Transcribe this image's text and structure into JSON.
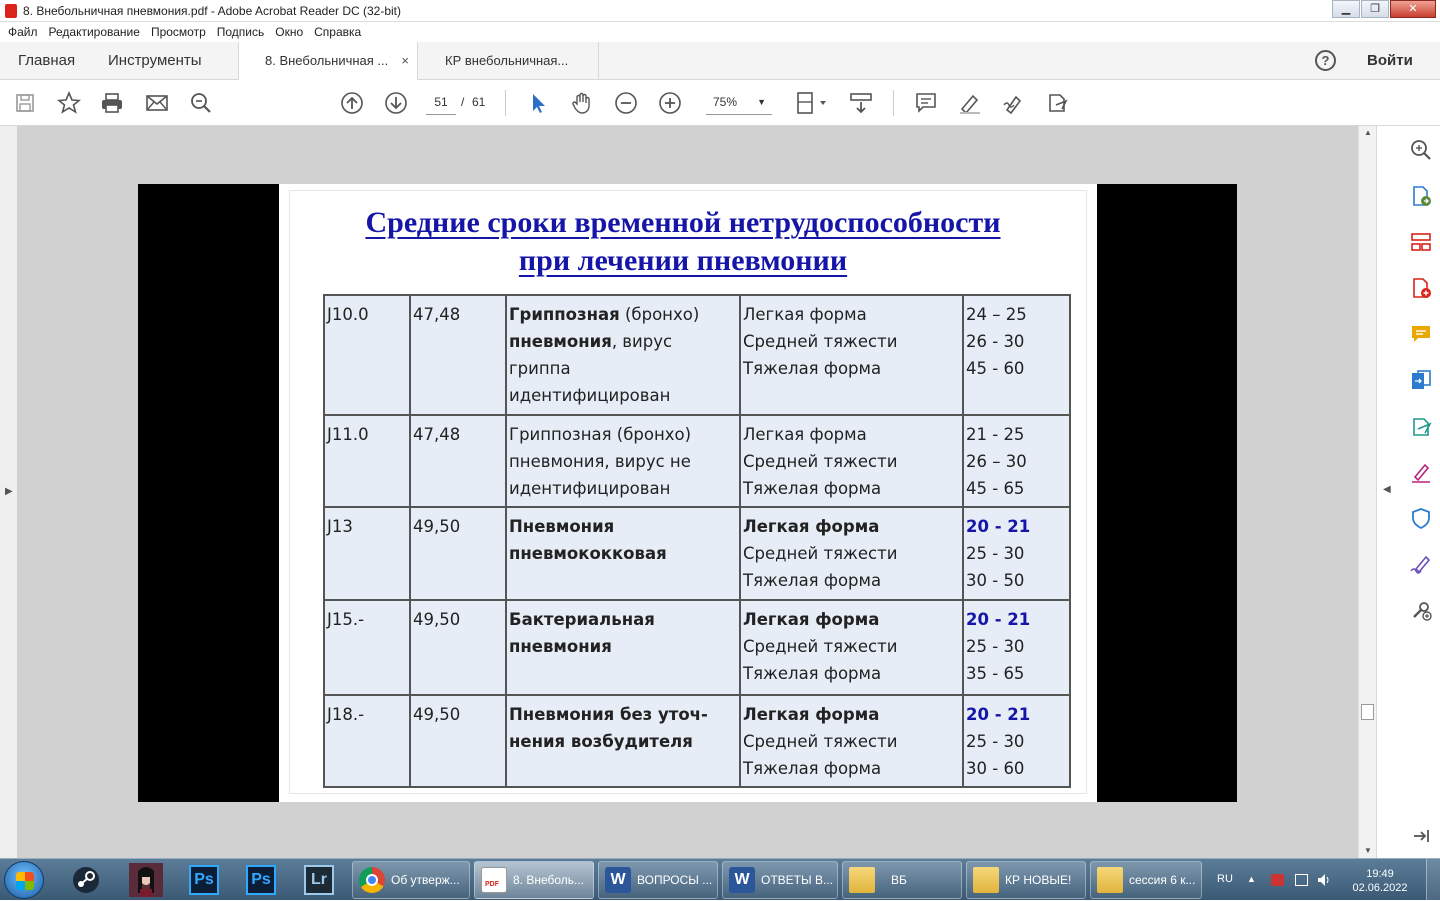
{
  "window": {
    "title": "8. Внебольничная пневмония.pdf - Adobe Acrobat Reader DC (32-bit)",
    "controls": {
      "minimize": "▁",
      "maximize": "❐",
      "close": "✕"
    }
  },
  "menu": [
    "Файл",
    "Редактирование",
    "Просмотр",
    "Подпись",
    "Окно",
    "Справка"
  ],
  "tabs": {
    "home": "Главная",
    "tools": "Инструменты",
    "doc1": "8. Внебольничная ...",
    "doc1_close": "×",
    "doc2": "КР внебольничная...",
    "help": "?",
    "signin": "Войти"
  },
  "toolbar": {
    "icons": [
      "save-icon",
      "bookmark-star-icon",
      "print-icon",
      "email-icon",
      "search-zoom-icon",
      "prev-page-icon",
      "next-page-icon",
      "select-cursor-icon",
      "hand-icon",
      "zoom-out-icon",
      "zoom-in-icon",
      "page-fit-icon",
      "scroll-mode-icon",
      "comment-icon",
      "highlight-icon",
      "sign-icon",
      "share-icon"
    ],
    "page_current": "51",
    "page_sep": "/",
    "page_total": "61",
    "zoom": "75%"
  },
  "right_panel": {
    "icons": [
      "zoom-search-icon",
      "export-pdf-icon",
      "organize-pages-icon",
      "create-pdf-icon",
      "comment-icon",
      "combine-files-icon",
      "send-review-icon",
      "fill-sign-icon",
      "protect-icon",
      "sign-pen-icon",
      "more-tools-icon",
      "collapse-panel-icon"
    ]
  },
  "slide": {
    "title_line1": "Средние сроки временной нетрудоспособности",
    "title_line2": "при лечении пневмонии",
    "rows": [
      {
        "code": "J10.0",
        "price": "47,48",
        "diag_bold1": "Гриппозная",
        "diag_reg1": " (бронхо)",
        "diag_bold2": "пневмония",
        "diag_reg2": ", вирус",
        "diag_reg3": "гриппа идентифицирован",
        "forms": [
          "Легкая форма",
          "Средней тяжести",
          "Тяжелая форма"
        ],
        "terms": [
          "24 – 25",
          "26 - 30",
          "45 - 60"
        ]
      },
      {
        "code": "J11.0",
        "price": "47,48",
        "diag_lines": [
          "Гриппозная (бронхо)",
          "пневмония, вирус не",
          "идентифицирован"
        ],
        "forms": [
          "Легкая форма",
          "Средней тяжести",
          "Тяжелая форма"
        ],
        "terms": [
          "21 - 25",
          "26 – 30",
          "45 - 65"
        ]
      },
      {
        "code": "J13",
        "price": "49,50",
        "diag_lines": [
          "Пневмония",
          "пневмококковая"
        ],
        "forms": [
          "Легкая форма",
          "Средней тяжести",
          "Тяжелая форма"
        ],
        "terms": [
          "20 - 21",
          "25 - 30",
          "30 - 50"
        ]
      },
      {
        "code": "J15.-",
        "price": "49,50",
        "diag_lines": [
          "Бактериальная",
          "пневмония"
        ],
        "forms": [
          "Легкая форма",
          "Средней тяжести",
          "Тяжелая форма"
        ],
        "terms": [
          "20 - 21",
          "25 - 30",
          "35 - 65"
        ]
      },
      {
        "code": "J18.-",
        "price": "49,50",
        "diag_lines": [
          "Пневмония без уточ-",
          "нения возбудителя"
        ],
        "forms": [
          "Легкая форма",
          "Средней тяжести",
          "Тяжелая форма"
        ],
        "terms": [
          "20 - 21",
          "25 - 30",
          "30 - 60"
        ]
      }
    ]
  },
  "taskbar": {
    "pinned": [
      "steam-icon",
      "game-avatar-icon",
      "photoshop-icon",
      "photoshop-icon",
      "lightroom-icon"
    ],
    "pinned_labels": [
      "Ps",
      "Ps",
      "Lr"
    ],
    "tasks": [
      {
        "label": "Об утверж...",
        "icon": "chrome-icon"
      },
      {
        "label": "8. Внеболь...",
        "icon": "pdf-icon",
        "icon_text": "PDF"
      },
      {
        "label": "ВОПРОСЫ ...",
        "icon": "word-icon",
        "icon_text": "W"
      },
      {
        "label": "ОТВЕТЫ В...",
        "icon": "word-icon",
        "icon_text": "W"
      },
      {
        "label": "ВБ",
        "icon": "folder-icon"
      },
      {
        "label": "КР НОВЫЕ!",
        "icon": "folder-icon"
      },
      {
        "label": "сессия 6 к...",
        "icon": "folder-icon"
      }
    ],
    "lang": "RU",
    "time": "19:49",
    "date": "02.06.2022"
  },
  "colors": {
    "title_blue": "#1515a8",
    "cell_bg": "#e6edf6",
    "viewer_bg": "#d1d1d1",
    "acrobat_red": "#d9231b",
    "right_panel_icons": [
      "#2d7bd0",
      "#5a8c3c",
      "#d9231b",
      "#e8a800",
      "#2d7bd0",
      "#1f9a8a",
      "#b3247a",
      "#2d7bd0",
      "#6b4fbb"
    ]
  }
}
